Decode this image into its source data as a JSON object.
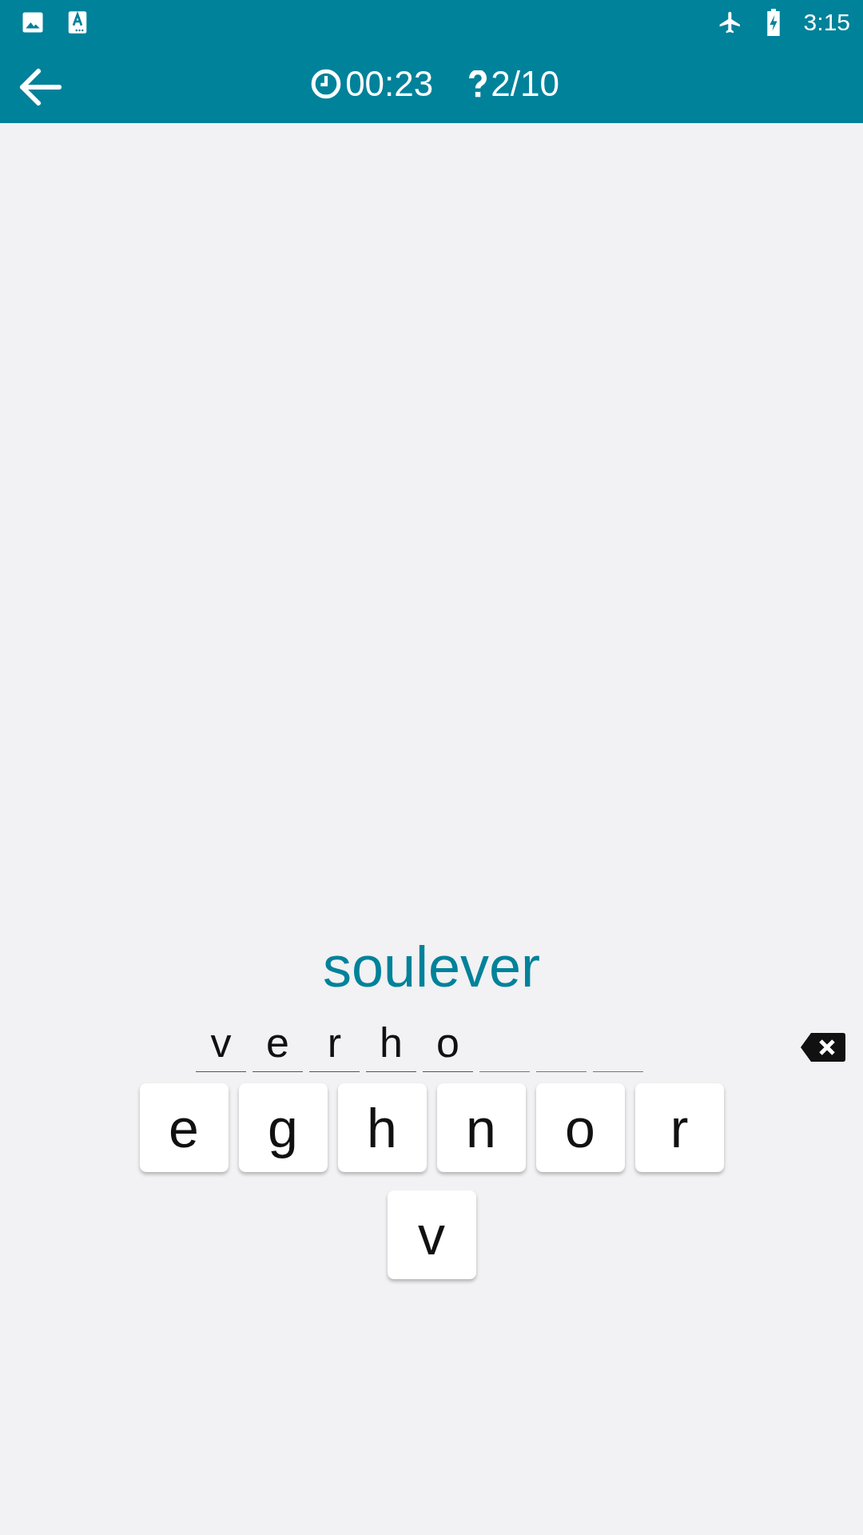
{
  "status_bar": {
    "time": "3:15"
  },
  "app_bar": {
    "timer": "00:23",
    "progress": "2/10"
  },
  "word": "soulever",
  "answer_slots": [
    {
      "letter": "v",
      "filled": true
    },
    {
      "letter": "e",
      "filled": true
    },
    {
      "letter": "r",
      "filled": true
    },
    {
      "letter": "h",
      "filled": true
    },
    {
      "letter": "o",
      "filled": true
    },
    {
      "filled": false
    },
    {
      "filled": false
    },
    {
      "filled": false
    }
  ],
  "key_rows": [
    [
      "e",
      "g",
      "h",
      "n",
      "o",
      "r"
    ],
    [
      "v"
    ]
  ]
}
